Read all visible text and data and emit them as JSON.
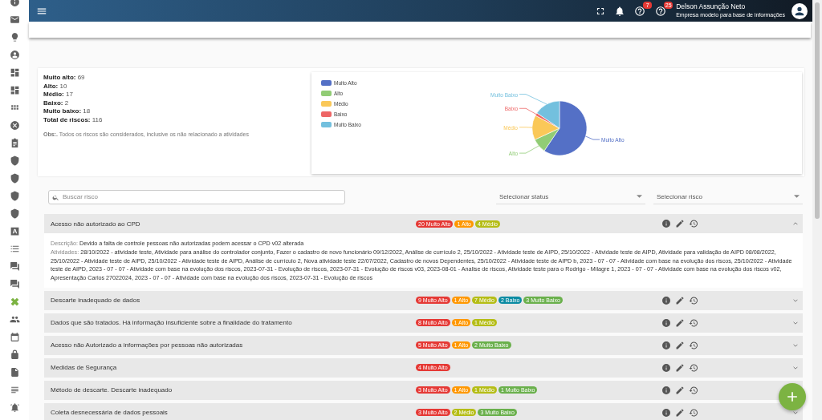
{
  "sidebar": {
    "items": [
      {
        "selected": false
      },
      {
        "selected": false
      },
      {
        "selected": false
      },
      {
        "selected": false
      },
      {
        "selected": false
      },
      {
        "selected": false
      },
      {
        "selected": false
      },
      {
        "selected": false
      },
      {
        "selected": false
      },
      {
        "selected": false
      },
      {
        "selected": false
      },
      {
        "selected": false
      },
      {
        "selected": false
      },
      {
        "selected": false
      },
      {
        "selected": false
      },
      {
        "selected": false
      },
      {
        "selected": false
      },
      {
        "selected": true
      },
      {
        "selected": false
      },
      {
        "selected": false
      },
      {
        "selected": false
      },
      {
        "selected": false
      },
      {
        "selected": false
      },
      {
        "selected": false
      }
    ]
  },
  "header": {
    "notifications": [
      {
        "count": "7"
      },
      {
        "count": "25"
      }
    ],
    "user_name": "Delson Assunção Neto",
    "company": "Empresa modelo para base de informações"
  },
  "summary": {
    "stats": [
      "**Muito alto:** 69",
      "**Alto:** 10",
      "**Médio:** 17",
      "**Baixo:** 2",
      "**Muito baixo:** 18",
      "**Total de riscos:** 116"
    ],
    "note": "**Obs:.** Todos os riscos são considerados, inclusive os não relacionado a atividades"
  },
  "chart": {
    "legend": [
      {
        "label": "Muito Alto",
        "color": "#5470c6"
      },
      {
        "label": "Alto",
        "color": "#91cc75"
      },
      {
        "label": "Médio",
        "color": "#fac858"
      },
      {
        "label": "Baixo",
        "color": "#ee6666"
      },
      {
        "label": "Muito Baixo",
        "color": "#73c0de"
      }
    ],
    "chart_data": {
      "type": "pie",
      "categories": [
        "Muito Alto",
        "Alto",
        "Médio",
        "Baixo",
        "Muito Baixo"
      ],
      "values": [
        59.48,
        8.62,
        14.66,
        1.72,
        15.52
      ]
    }
  },
  "filters": {
    "search": {
      "placeholder": "Buscar risco"
    },
    "status_select": {
      "placeholder": "Selecionar status"
    },
    "risk_select": {
      "placeholder": "Selecionar risco"
    }
  },
  "risks": [
    {
      "title": "Acesso não autorizado ao CPD",
      "expanded": true,
      "badges": [
        {
          "label": "20 Muito Alto",
          "kind": "muito_alto"
        },
        {
          "label": "1 Alto",
          "kind": "alto"
        },
        {
          "label": "4 Médio",
          "kind": "medio"
        }
      ],
      "description_label": "Descrição:",
      "description": "Devido a falta de controle pessoas não autorizadas podem acessar o CPD v02 alterada",
      "activities_label": "Atividades:",
      "activities": "28/10/2022 - atividade teste, Atividade para análise do controlador conjunto, Fazer o cadastro de novo funcionário 09/12/2022, Análise de currículo 2, 25/10/2022 - Atividade teste de AIPD, 25/10/2022 - Atividade teste de AIPD, Atividade para validação de AIPD 08/08/2022, 25/10/2022 - Atividade teste de AIPD, 25/10/2022 - Atividade teste de AIPD, Análise de currículo 2, Nova atividade teste 22/07/2022, Cadastro de novos Dependentes, 25/10/2022 - Atividade teste de AIPD b, 2023 - 07 - 07 - Atividade com base na evolução dos riscos, 25/10/2022 - Atividade teste de AIPD, 2023 - 07 - 07 - Atividade com base na evolução dos riscos, 2023-07-31 - Evolução de riscos, 2023-07-31 - Evolução de riscos v03, 2023-08-01 - Analise de riscos, Atividade teste para o Rodrigo - Milagre 1, 2023 - 07 - 07 - Atividade com base na evolução dos riscos v02, Apresentação Carlos 27022024, 2023 - 07 - 07 - Atividade com base na evolução dos riscos, 2023-07-31 - Evolução de riscos"
    },
    {
      "title": "Descarte inadequado de dados",
      "expanded": false,
      "badges": [
        {
          "label": "9 Muito Alto",
          "kind": "muito_alto"
        },
        {
          "label": "1 Alto",
          "kind": "alto"
        },
        {
          "label": "7 Médio",
          "kind": "medio"
        },
        {
          "label": "2 Baixo",
          "kind": "baixo"
        },
        {
          "label": "3 Muito Baixo",
          "kind": "muito_baixo"
        }
      ]
    },
    {
      "title": "Dados que são tratados. Há informação insuficiente sobre a finalidade do tratamento",
      "expanded": false,
      "badges": [
        {
          "label": "8 Muito Alto",
          "kind": "muito_alto"
        },
        {
          "label": "1 Alto",
          "kind": "alto"
        },
        {
          "label": "1 Médio",
          "kind": "medio"
        }
      ]
    },
    {
      "title": "Acesso não Autorizado a informações por pessoas não autorizadas",
      "expanded": false,
      "badges": [
        {
          "label": "5 Muito Alto",
          "kind": "muito_alto"
        },
        {
          "label": "1 Alto",
          "kind": "alto"
        },
        {
          "label": "2 Muito Baixo",
          "kind": "muito_baixo"
        }
      ]
    },
    {
      "title": "Medidas de Segurança",
      "expanded": false,
      "badges": [
        {
          "label": "4 Muito Alto",
          "kind": "muito_alto"
        }
      ]
    },
    {
      "title": "Método de descarte. Descarte inadequado",
      "expanded": false,
      "badges": [
        {
          "label": "3 Muito Alto",
          "kind": "muito_alto"
        },
        {
          "label": "1 Alto",
          "kind": "alto"
        },
        {
          "label": "1 Médio",
          "kind": "medio"
        },
        {
          "label": "1 Muito Baixo",
          "kind": "muito_baixo"
        }
      ]
    },
    {
      "title": "Coleta desnecessária de dados pessoais",
      "expanded": false,
      "badges": [
        {
          "label": "3 Muito Alto",
          "kind": "muito_alto"
        },
        {
          "label": "2 Médio",
          "kind": "medio"
        },
        {
          "label": "3 Muito Baixo",
          "kind": "muito_baixo"
        }
      ]
    }
  ]
}
